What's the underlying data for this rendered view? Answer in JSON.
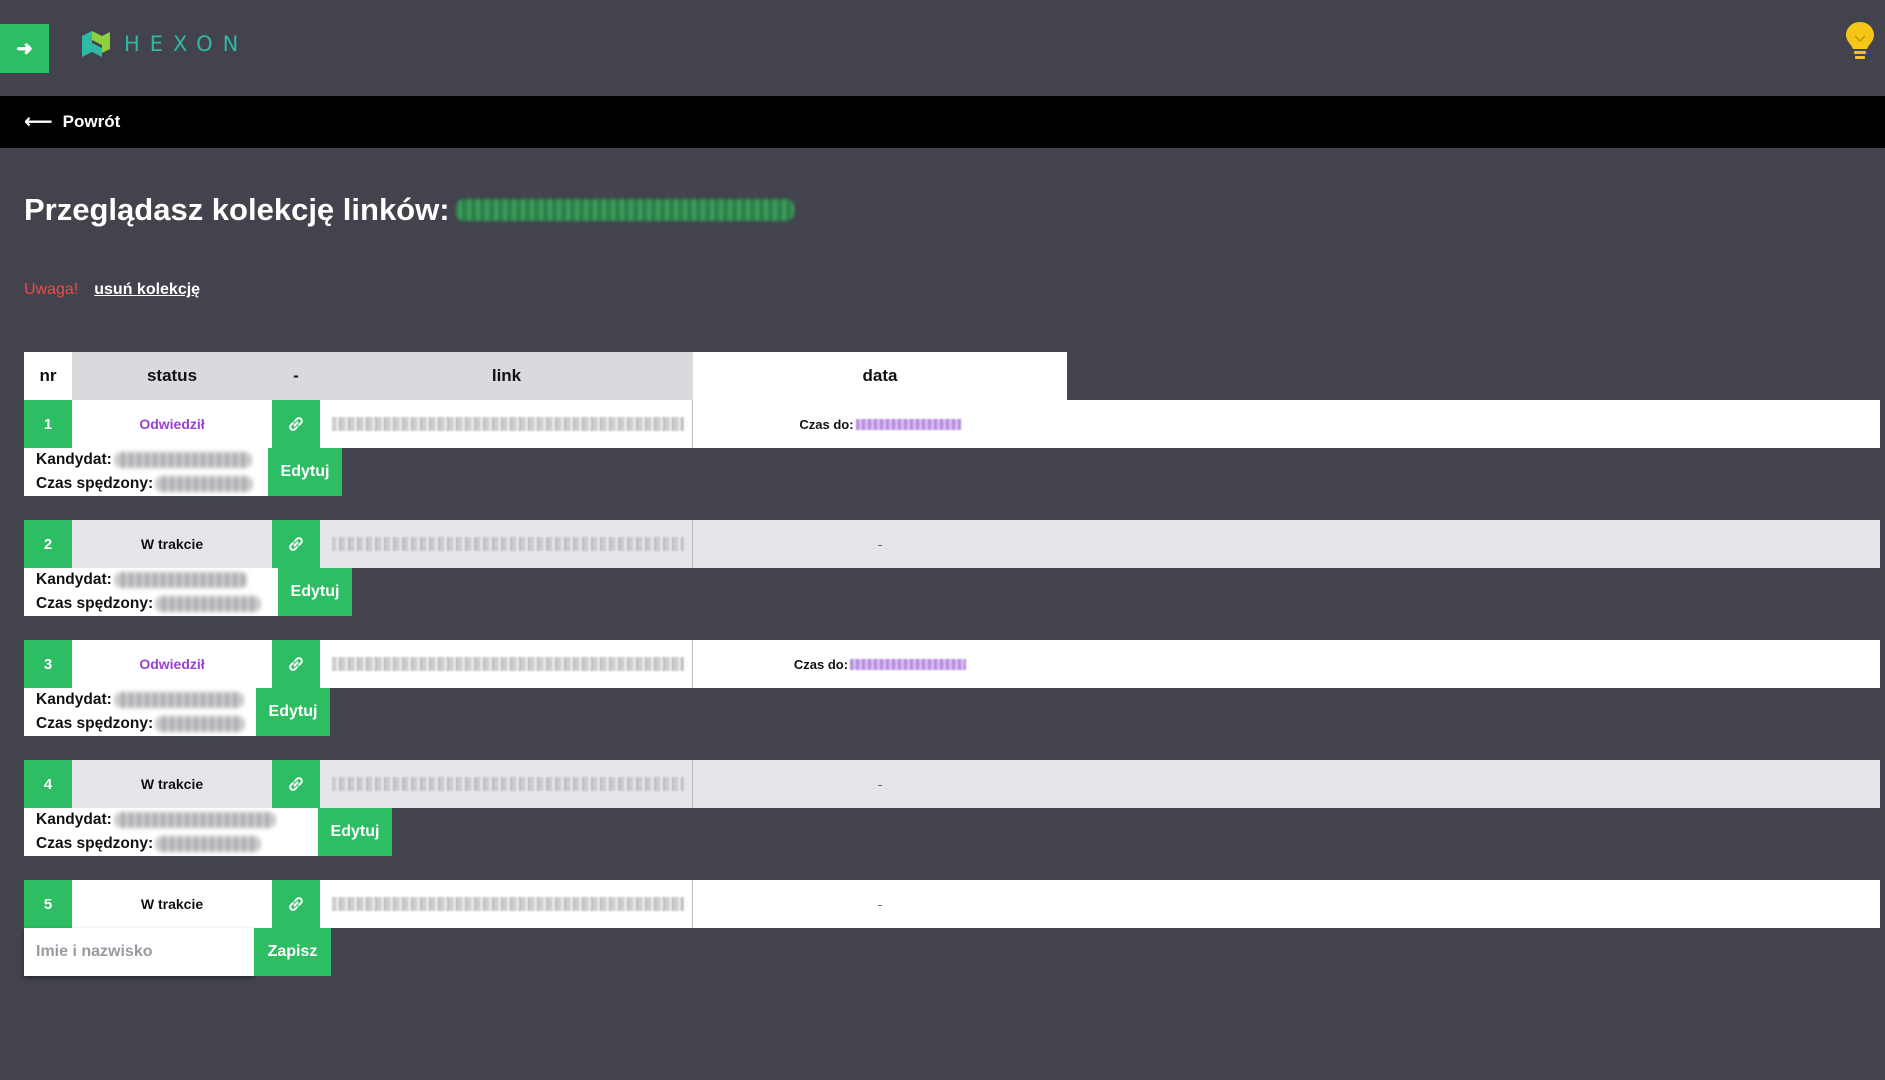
{
  "app": {
    "logo_text": "HEXON",
    "accent_color": "#2dbd62",
    "background_color": "#42434c"
  },
  "icons": {
    "menu_toggle": "arrow-right-icon",
    "help": "lightbulb-icon",
    "back": "arrow-left-icon",
    "row_link": "link-icon"
  },
  "backbar": {
    "label": "Powrót"
  },
  "page": {
    "heading": "Przeglądasz kolekcję linków:",
    "warning_label": "Uwaga!",
    "delete_link": "usuń kolekcję"
  },
  "table": {
    "headers": {
      "nr": "nr",
      "status": "status",
      "dash": "-",
      "link": "link",
      "data": "data"
    },
    "rows": [
      {
        "nr": "1",
        "status": "Odwiedził",
        "status_kind": "visited",
        "date_label": "Czas do:",
        "has_date": true,
        "candidate_label": "Kandydat:",
        "time_label": "Czas spędzony:",
        "action": "Edytuj",
        "editable": false
      },
      {
        "nr": "2",
        "status": "W trakcie",
        "status_kind": "progress",
        "date_label": "-",
        "has_date": false,
        "candidate_label": "Kandydat:",
        "time_label": "Czas spędzony:",
        "action": "Edytuj",
        "editable": false
      },
      {
        "nr": "3",
        "status": "Odwiedził",
        "status_kind": "visited",
        "date_label": "Czas do:",
        "has_date": true,
        "candidate_label": "Kandydat:",
        "time_label": "Czas spędzony:",
        "action": "Edytuj",
        "editable": false
      },
      {
        "nr": "4",
        "status": "W trakcie",
        "status_kind": "progress",
        "date_label": "-",
        "has_date": false,
        "candidate_label": "Kandydat:",
        "time_label": "Czas spędzony:",
        "action": "Edytuj",
        "editable": false
      },
      {
        "nr": "5",
        "status": "W trakcie",
        "status_kind": "progress",
        "date_label": "-",
        "has_date": false,
        "input_placeholder": "Imie i nazwisko",
        "action": "Zapisz",
        "editable": true
      }
    ]
  }
}
